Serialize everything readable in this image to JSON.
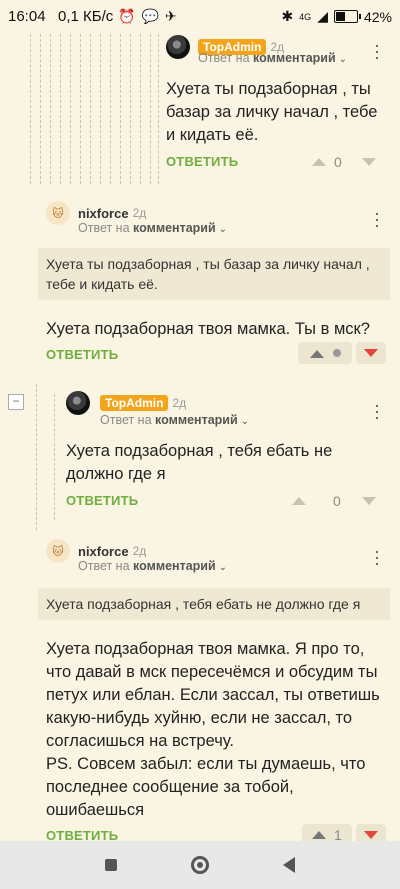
{
  "status_bar": {
    "time": "16:04",
    "network_speed": "0,1 КБ/с",
    "signal": "4G",
    "battery": "42%"
  },
  "comments": [
    {
      "author": "TopAdmin",
      "time": "2д",
      "reply_label": "Ответ на",
      "reply_target": "комментарий",
      "text": "Хуета ты подзаборная , ты базар за личку начал , тебе и кидать её.",
      "reply_button": "ОТВЕТИТЬ",
      "votes": "0"
    },
    {
      "author": "nixforce",
      "time": "2д",
      "reply_label": "Ответ на",
      "reply_target": "комментарий",
      "quote": "Хуета ты подзаборная , ты базар за личку начал , тебе и кидать её.",
      "text": "Хуета подзаборная твоя мамка. Ты в мск?",
      "reply_button": "ОТВЕТИТЬ"
    },
    {
      "author": "TopAdmin",
      "time": "2д",
      "reply_label": "Ответ на",
      "reply_target": "комментарий",
      "text": "Хуета подзаборная , тебя ебать не должно где я",
      "reply_button": "ОТВЕТИТЬ",
      "votes": "0"
    },
    {
      "author": "nixforce",
      "time": "2д",
      "reply_label": "Ответ на",
      "reply_target": "комментарий",
      "quote": "Хуета подзаборная , тебя ебать не должно где я",
      "text": "Хуета подзаборная твоя мамка. Я про то, что давай в мск пересечёмся и обсудим ты петух или еблан. Если зассал, ты ответишь какую-нибудь хуйню, если не зассал, то согласишься на встречу.\nPS. Совсем забыл: если ты думаешь, что последнее сообщение за тобой, ошибаешься",
      "reply_button": "ОТВЕТИТЬ",
      "votes": "1"
    }
  ],
  "colors": {
    "background": "#faf5e3",
    "reply_green": "#6fad3f",
    "downvote_red": "#e3453b",
    "badge_orange": "#f2a51a"
  }
}
